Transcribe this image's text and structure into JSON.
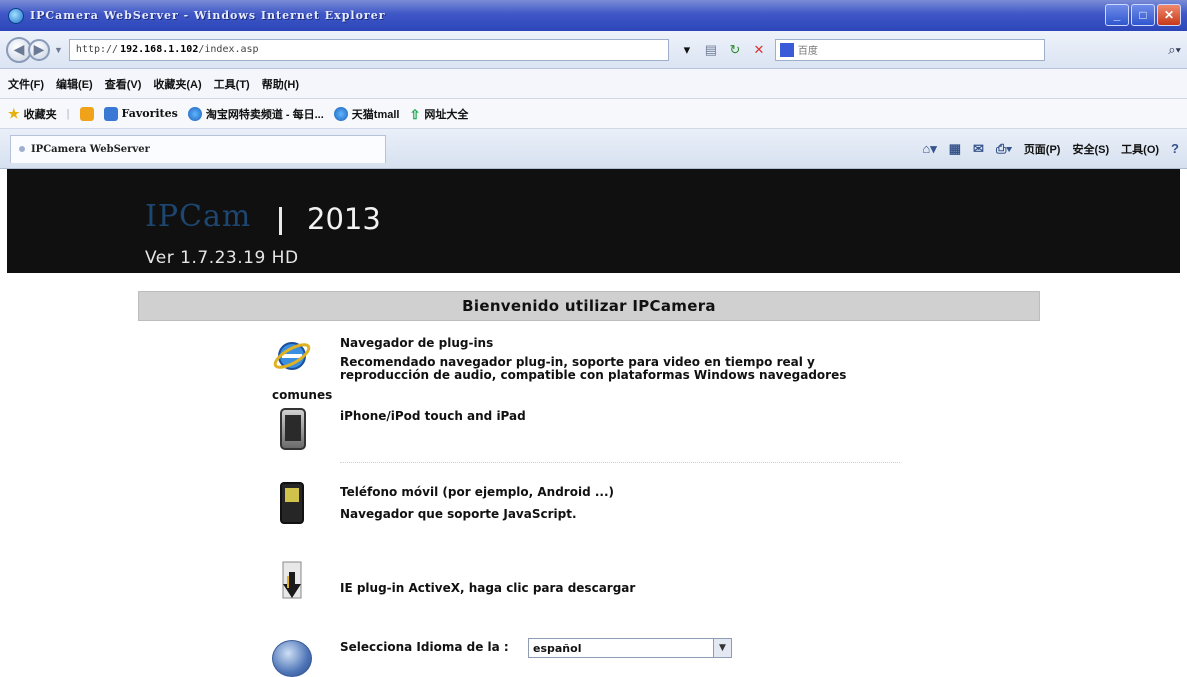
{
  "window": {
    "title": "IPCamera WebServer - Windows Internet Explorer",
    "controls": {
      "minimize": "_",
      "maximize": "□",
      "close": "✕"
    }
  },
  "addressbar": {
    "url_prefix": "http://",
    "url_host": "192.168.1.102",
    "url_path": "/index.asp",
    "search_placeholder": "百度",
    "back_symbol": "◀",
    "forward_symbol": "▶"
  },
  "menubar": {
    "items": [
      "文件(F)",
      "编辑(E)",
      "查看(V)",
      "收藏夹(A)",
      "工具(T)",
      "帮助(H)"
    ]
  },
  "favorites": {
    "label": "收藏夹",
    "items": [
      "Favorites",
      "淘宝网特卖频道 - 每日...",
      "天猫tmall",
      "网址大全"
    ]
  },
  "tabbar": {
    "tab_label": "IPCamera WebServer",
    "commands": [
      "页面(P)",
      "安全(S)",
      "工具(O)"
    ],
    "help_symbol": "?"
  },
  "banner": {
    "brand": "IPCam",
    "year": "2013",
    "version": "Ver 1.7.23.19 HD"
  },
  "content": {
    "welcome": "Bienvenido utilizar IPCamera",
    "plugin_title": "Navegador de plug-ins",
    "plugin_desc_1": "Recomendado navegador plug-in, soporte para video en tiempo real y",
    "plugin_desc_2": "reproducción de audio, compatible con plataformas Windows navegadores",
    "plugin_desc_3": "comunes",
    "iphone_title": "iPhone/iPod touch and iPad",
    "mobile_title": "Teléfono móvil (por ejemplo, Android ...)",
    "mobile_desc": "Navegador que soporte JavaScript.",
    "activex_title": "IE plug-in ActiveX, haga clic para descargar",
    "language_label": "Selecciona Idioma de la :",
    "language_value": "español"
  }
}
